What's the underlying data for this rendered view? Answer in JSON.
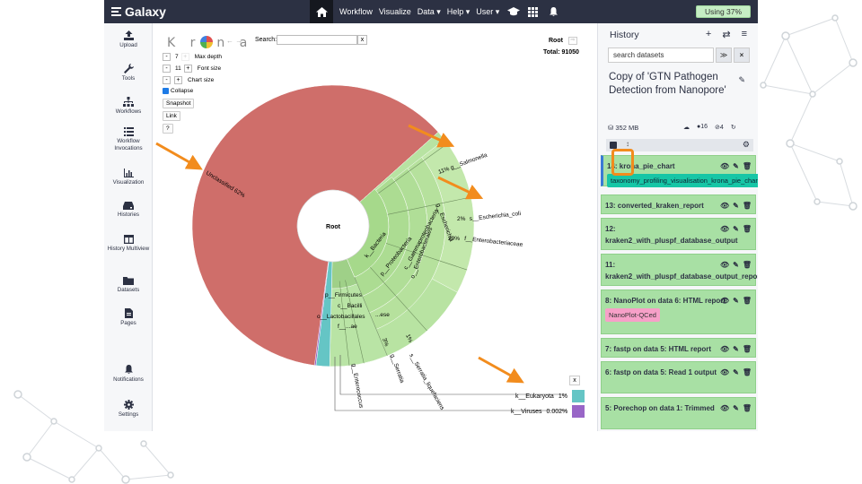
{
  "colors": {
    "masthead": "#2c3143",
    "unclassified": "#cf6e6a",
    "bacteria": "#b8e3a2",
    "eukaryota": "#65c5c5",
    "viruses": "#9966c7",
    "history_item": "#a8e0a4",
    "highlight": "#f28c1d"
  },
  "masthead": {
    "brand": "Galaxy",
    "nav": [
      "Workflow",
      "Visualize",
      "Data ▾",
      "Help ▾",
      "User ▾"
    ],
    "quota": "Using 37%"
  },
  "activity_bar": [
    {
      "label": "Upload",
      "icon": "upload-icon"
    },
    {
      "label": "Tools",
      "icon": "wrench-icon"
    },
    {
      "label": "Workflows",
      "icon": "sitemap-icon"
    },
    {
      "label": "Workflow Invocations",
      "icon": "list-icon"
    },
    {
      "label": "Visualization",
      "icon": "chart-icon"
    },
    {
      "label": "Histories",
      "icon": "hdd-icon"
    },
    {
      "label": "History Multiview",
      "icon": "columns-icon"
    },
    {
      "label": "Datasets",
      "icon": "folder-icon"
    },
    {
      "label": "Pages",
      "icon": "file-icon"
    },
    {
      "label": "Notifications",
      "icon": "bell-icon"
    },
    {
      "label": "Settings",
      "icon": "gear-icon"
    }
  ],
  "krona": {
    "logo": "Krona",
    "search_label": "Search:",
    "search_value": "",
    "clear": "x",
    "max_depth": {
      "value": "7",
      "label": "Max depth"
    },
    "font_size": {
      "value": "11",
      "label": "Font size"
    },
    "chart_size": {
      "label": "Chart size"
    },
    "collapse": "Collapse",
    "buttons": [
      "Snapshot",
      "Link",
      "?"
    ],
    "root_label": "Root",
    "total": "Total: 91050",
    "center": "Root",
    "labels": {
      "unclassified": "Unclassified  62%",
      "salmonella": "11%  g__Salmonella",
      "ecoli_pct": "2%",
      "ecoli": "s__Escherichia_coli",
      "entero_pct": "29%",
      "entero": "f__Enterobacteriaceae",
      "escherichia": "g__Escherichia",
      "bacteria": "k__Bacteria",
      "proteo": "p__Proteobacteria",
      "gamma": "c__Gammaproteobacteria",
      "enterobact": "o__Enterobacterales",
      "firmicutes": "p__Firmicutes",
      "bacilli": "c__Bacilli",
      "lacto": "o__Lactobacillales",
      "f_ae": "f__...ae",
      "ese": "...ese",
      "pct3": "3%",
      "pct1": "1%",
      "enterococcus": "g__Enterococcus",
      "serratia": "g__Serratia",
      "serratia_liq": "s__Serratia_liquefaciens"
    },
    "legend": [
      {
        "name": "k__Eukaryota",
        "pct": "1%"
      },
      {
        "name": "k__Viruses",
        "pct": "0.002%"
      }
    ]
  },
  "chart_data": {
    "type": "sunburst",
    "title": "",
    "total": 91050,
    "slices": [
      {
        "name": "Unclassified",
        "percent": 62
      },
      {
        "name": "k__Bacteria",
        "percent": 37
      },
      {
        "name": "k__Eukaryota",
        "percent": 1
      },
      {
        "name": "k__Viruses",
        "percent": 0.002
      }
    ],
    "children": [
      {
        "name": "g__Salmonella",
        "percent": 11
      },
      {
        "name": "f__Enterobacteriaceae",
        "percent": 29
      },
      {
        "name": "s__Escherichia_coli",
        "percent": 2
      }
    ]
  },
  "history": {
    "title": "History",
    "search_placeholder": "search datasets",
    "name": "Copy of 'GTN Pathogen Detection from Nanopore'",
    "size": "352 MB",
    "count_shown": "16",
    "count_hidden": "4",
    "items": [
      {
        "label": "14: krona_pie_chart",
        "tag": "taxonomy_profiling_visualisation_krona_pie_chart"
      },
      {
        "label": "13: converted_kraken_report"
      },
      {
        "label": "12: kraken2_with_pluspf_database_output"
      },
      {
        "label": "11: kraken2_with_pluspf_database_output_report"
      },
      {
        "label": "8: NanoPlot on data 6: HTML report",
        "tag": "NanoPlot-QCed"
      },
      {
        "label": "7: fastp on data 5: HTML report"
      },
      {
        "label": "6: fastp on data 5: Read 1 output"
      },
      {
        "label": "5: Porechop on data 1: Trimmed"
      }
    ]
  }
}
